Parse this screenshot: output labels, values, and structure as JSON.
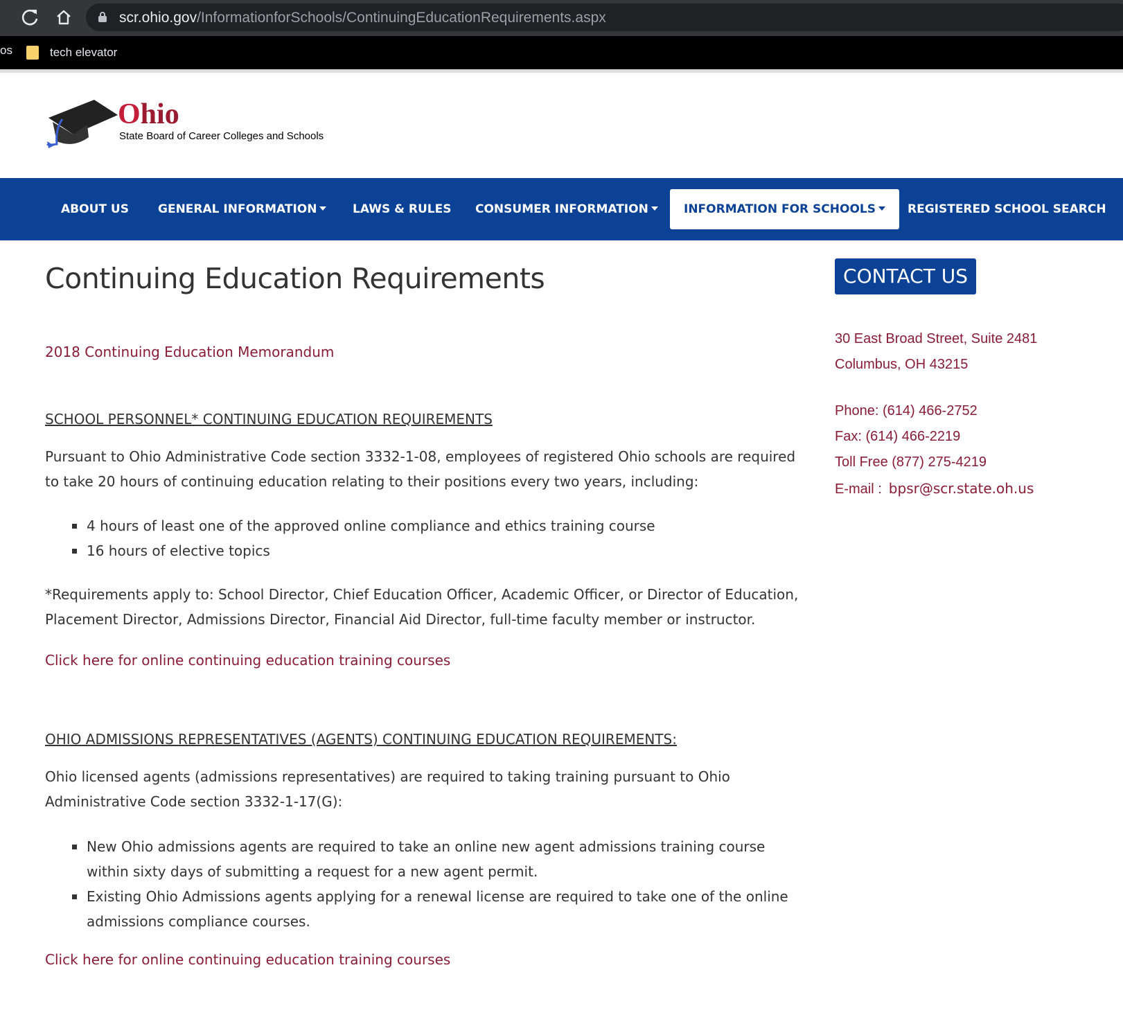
{
  "browser": {
    "url_host": "scr.ohio.gov",
    "url_path": "/InformationforSchools/ContinuingEducationRequirements.aspx",
    "bookmarks_partial": "os",
    "bookmark_folder": "tech elevator"
  },
  "logo": {
    "word_first": "O",
    "word_rest": "hio",
    "subtitle": "State Board of Career Colleges and Schools",
    "colors": {
      "brand_red": "#9b1b30",
      "cap_black": "#222222",
      "tassel_blue": "#3a5fcd"
    }
  },
  "nav": {
    "items": [
      {
        "label": "ABOUT US",
        "has_dropdown": false
      },
      {
        "label": "GENERAL INFORMATION",
        "has_dropdown": true
      },
      {
        "label": "LAWS & RULES",
        "has_dropdown": false
      },
      {
        "label": "CONSUMER INFORMATION",
        "has_dropdown": true
      },
      {
        "label": "INFORMATION FOR SCHOOLS",
        "has_dropdown": true,
        "active": true
      },
      {
        "label": "REGISTERED SCHOOL SEARCH",
        "has_dropdown": false
      }
    ]
  },
  "main": {
    "title": "Continuing Education Requirements",
    "memo_link": "2018 Continuing Education Memorandum",
    "section1": {
      "heading": "SCHOOL PERSONNEL* CONTINUING EDUCATION REQUIREMENTS",
      "intro": "Pursuant to Ohio Administrative Code section 3332-1-08, employees of registered Ohio schools are required to take 20 hours of continuing education relating to their positions every two years, including:",
      "bullets": [
        "4 hours of least one of the approved online compliance and ethics training course",
        "16 hours of elective topics"
      ],
      "footnote": "*Requirements apply to: School Director, Chief Education Officer, Academic Officer, or Director of Education, Placement Director, Admissions Director, Financial Aid Director, full-time faculty member or instructor.",
      "link": "Click here for online continuing education training courses"
    },
    "section2": {
      "heading": "OHIO ADMISSIONS REPRESENTATIVES (AGENTS) CONTINUING EDUCATION REQUIREMENTS:",
      "intro": "Ohio licensed agents (admissions representatives) are required to taking training pursuant to Ohio Administrative Code section 3332-1-17(G):",
      "bullets": [
        "New Ohio admissions agents are required to take an online new agent admissions training course within sixty days of submitting a request for a new agent permit.",
        "Existing Ohio Admissions agents applying for a renewal license are required to take one of the online admissions compliance courses."
      ],
      "link": "Click here for online continuing education training courses"
    }
  },
  "sidebar": {
    "contact_button": "CONTACT US",
    "address_line1": "30 East Broad Street, Suite 2481",
    "address_line2": "Columbus, OH 43215",
    "phone": "Phone: (614) 466-2752",
    "fax": "Fax: (614) 466-2219",
    "toll_free": "Toll Free (877) 275-4219",
    "email_label": "E-mail :",
    "email": "bpsr@scr.state.oh.us"
  },
  "colors": {
    "nav_blue": "#0b4295",
    "link_maroon": "#8a1c36",
    "text_gray": "#333333"
  }
}
